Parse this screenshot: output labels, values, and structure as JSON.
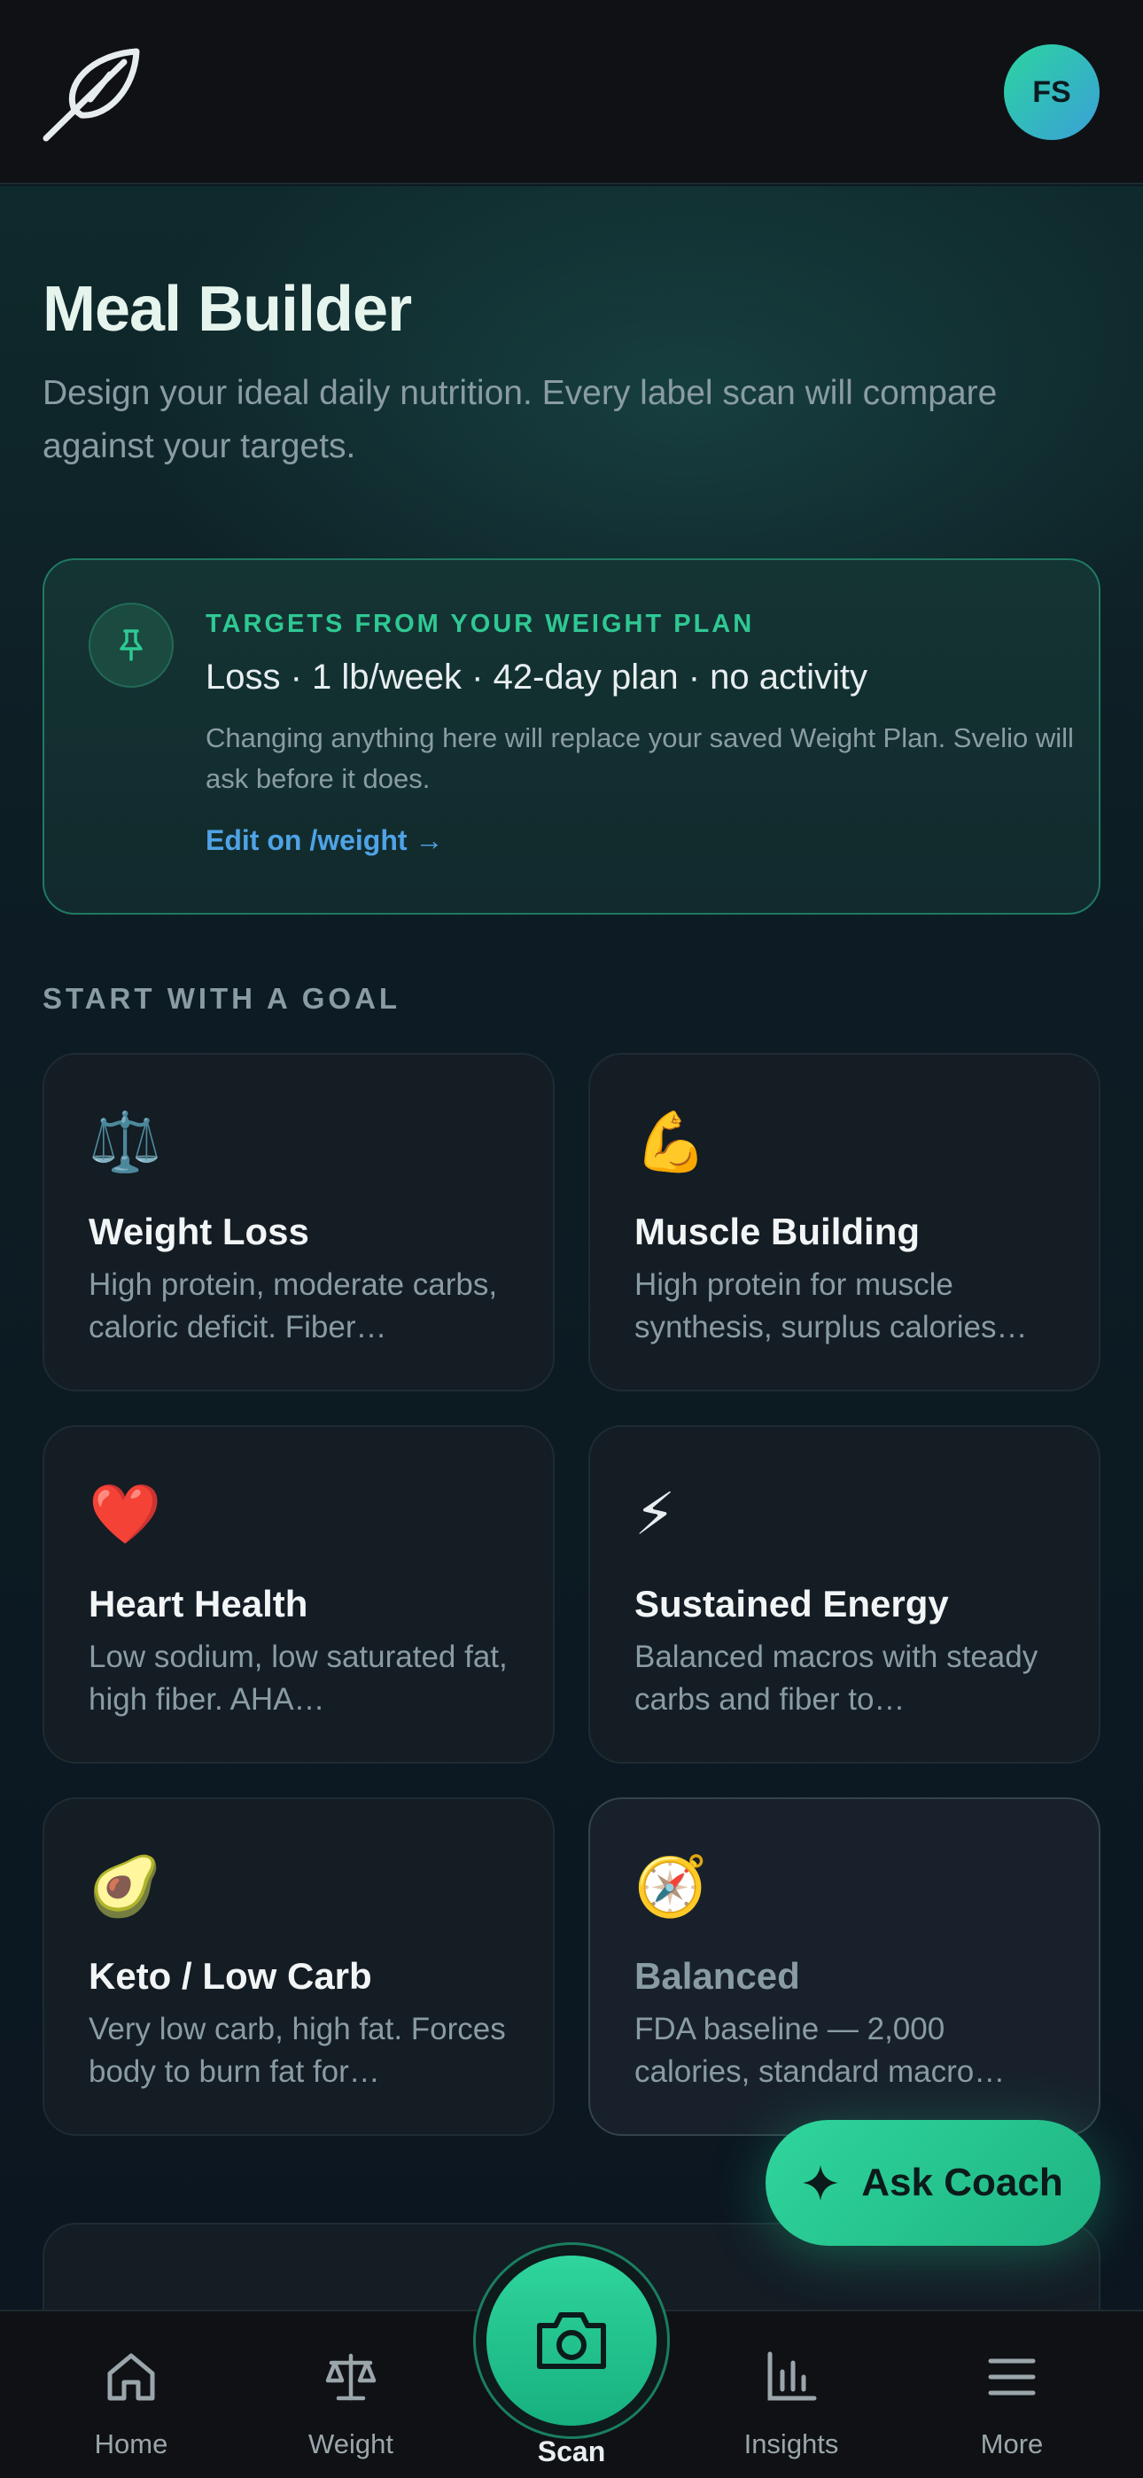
{
  "header": {
    "logo_icon": "leaf-logo-icon",
    "avatar_initials": "FS"
  },
  "page": {
    "title": "Meal Builder",
    "subtitle": "Design your ideal daily nutrition. Every label scan will compare against your targets."
  },
  "target_card": {
    "icon": "pin-icon",
    "eyebrow": "TARGETS FROM YOUR WEIGHT PLAN",
    "headline": "Loss · 1 lb/week · 42-day plan · no activity",
    "body": "Changing anything here will replace your saved Weight Plan. Svelio will ask before it does.",
    "link": "Edit on /weight →"
  },
  "goals_section": {
    "label": "START WITH A GOAL",
    "goals": [
      {
        "emoji": "⚖️",
        "title": "Weight Loss",
        "description": "High protein, moderate carbs, caloric deficit. Fiber…"
      },
      {
        "emoji": "💪",
        "title": "Muscle Building",
        "description": "High protein for muscle synthesis, surplus calories…"
      },
      {
        "emoji": "❤️",
        "title": "Heart Health",
        "description": "Low sodium, low saturated fat, high fiber. AHA…"
      },
      {
        "emoji": "⚡",
        "title": "Sustained Energy",
        "description": "Balanced macros with steady carbs and fiber to…"
      },
      {
        "emoji": "🥑",
        "title": "Keto / Low Carb",
        "description": "Very low carb, high fat. Forces body to burn fat for…"
      },
      {
        "emoji": "🧭",
        "title": "Balanced",
        "description": "FDA baseline — 2,000 calories, standard macro…"
      }
    ]
  },
  "fab": {
    "icon": "sparkle-icon",
    "label": "Ask Coach"
  },
  "bottom_nav": {
    "items": [
      {
        "icon": "home-icon",
        "label": "Home"
      },
      {
        "icon": "scale-icon",
        "label": "Weight"
      },
      {
        "icon": "camera-icon",
        "label": "Scan"
      },
      {
        "icon": "bar-chart-icon",
        "label": "Insights"
      },
      {
        "icon": "menu-icon",
        "label": "More"
      }
    ]
  },
  "colors": {
    "accent": "#2fc893",
    "link": "#4fa3e6",
    "background": "#0d1a20",
    "card": "#141c24"
  }
}
